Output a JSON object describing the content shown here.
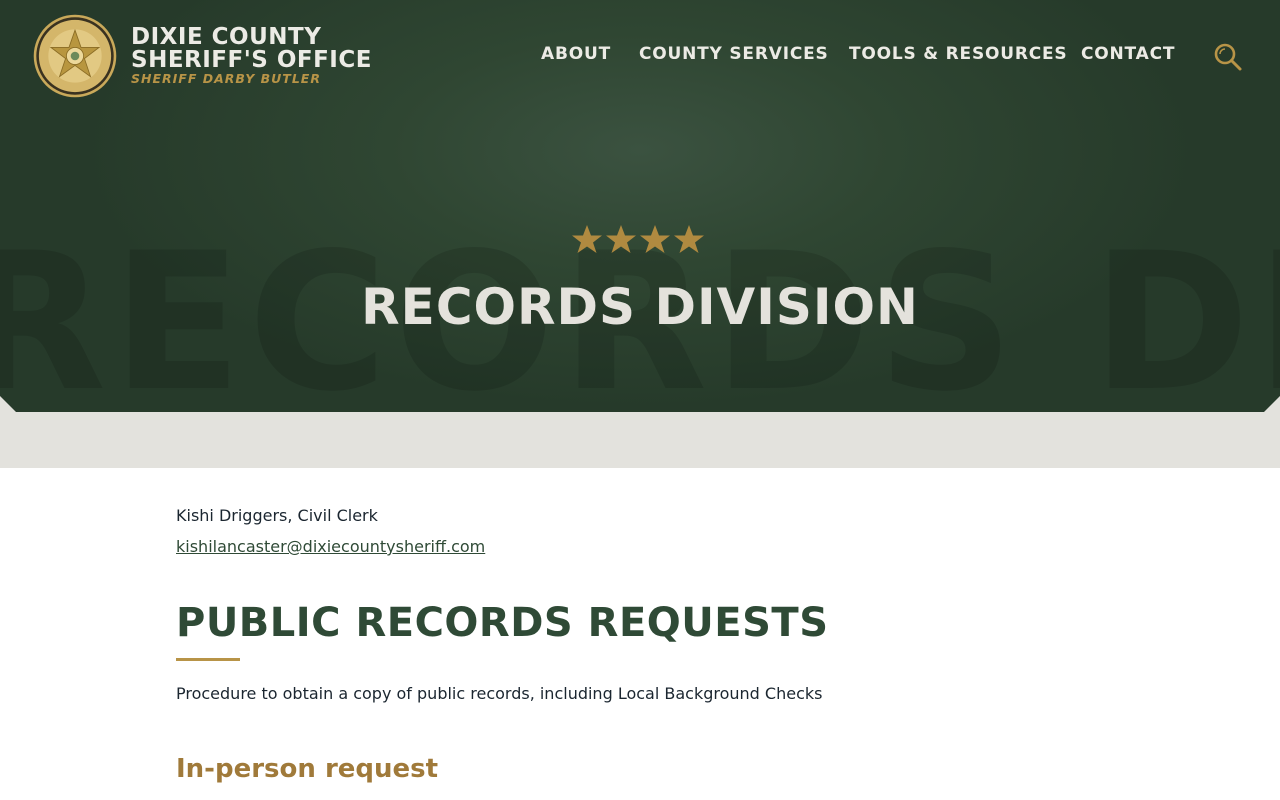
{
  "header": {
    "brand_line1": "DIXIE COUNTY",
    "brand_line2": "SHERIFF'S OFFICE",
    "brand_sub": "SHERIFF DARBY BUTLER",
    "logo_icon": "sheriff-star-badge-icon",
    "nav": [
      {
        "label": "ABOUT"
      },
      {
        "label": "COUNTY SERVICES"
      },
      {
        "label": "TOOLS & RESOURCES"
      },
      {
        "label": "CONTACT"
      }
    ],
    "search_icon": "search-icon"
  },
  "hero": {
    "watermark": "RECORDS DIVISION",
    "title": "RECORDS DIVISION",
    "star_count": 4,
    "star_icon": "star-icon"
  },
  "contact": {
    "name": "Kishi Driggers, Civil Clerk",
    "email": "kishilancaster@dixiecountysheriff.com"
  },
  "section": {
    "title": "PUBLIC RECORDS REQUESTS",
    "description": "Procedure to obtain a copy of public records, including Local Background Checks",
    "subheading": "In-person request"
  },
  "colors": {
    "hero_green": "#2f4632",
    "gold": "#b89447",
    "heading_green": "#2f4a36",
    "band_gray": "#e3e2dd",
    "text_dark": "#1b2630"
  }
}
